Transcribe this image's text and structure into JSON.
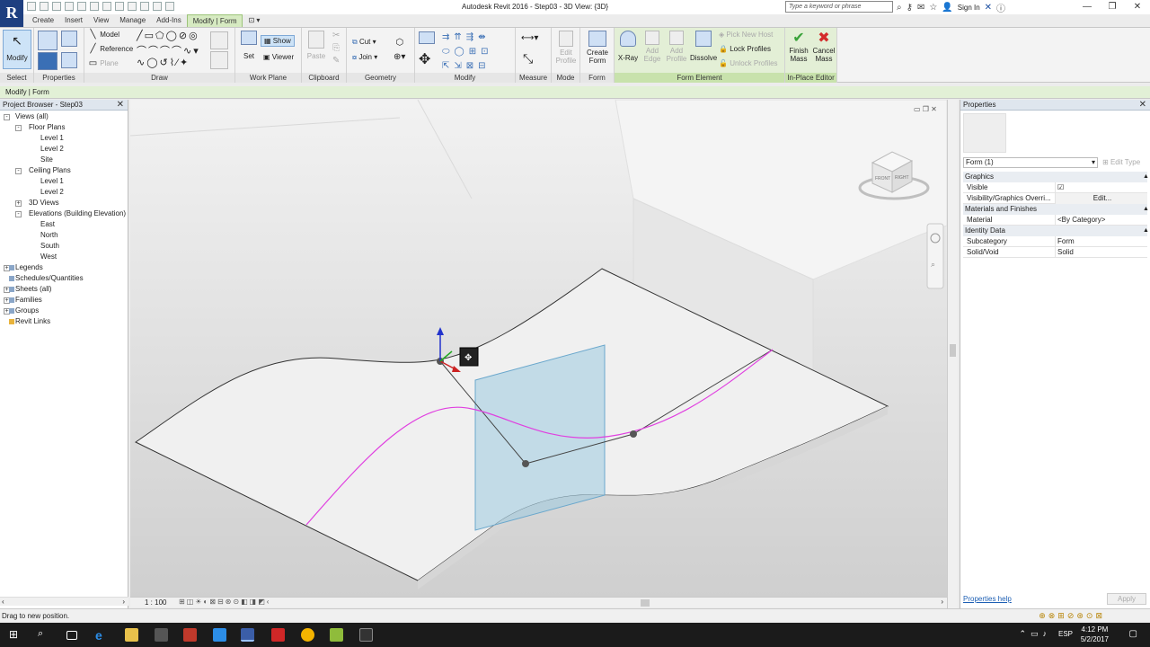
{
  "app": {
    "logo": "R",
    "title": "Autodesk Revit 2016 -    Step03 - 3D View: {3D}",
    "search_placeholder": "Type a keyword or phrase",
    "sign_in": "Sign In"
  },
  "tabs": [
    "Create",
    "Insert",
    "View",
    "Manage",
    "Add-Ins",
    "Modify | Form"
  ],
  "ribbon": {
    "select": {
      "modify": "Modify",
      "title": "Select"
    },
    "properties": {
      "title": "Properties"
    },
    "draw": {
      "model": "Model",
      "reference": "Reference",
      "plane": "Plane",
      "title": "Draw"
    },
    "work_plane": {
      "set": "Set",
      "show": "Show",
      "viewer": "Viewer",
      "title": "Work Plane"
    },
    "clipboard": {
      "paste": "Paste",
      "title": "Clipboard"
    },
    "geometry": {
      "cut": "Cut",
      "join": "Join",
      "title": "Geometry"
    },
    "modify": {
      "title": "Modify"
    },
    "measure": {
      "title": "Measure"
    },
    "mode": {
      "edit_profile": "Edit Profile",
      "title": "Mode"
    },
    "form": {
      "create_form": "Create Form",
      "title": "Form"
    },
    "form_element": {
      "xray": "X-Ray",
      "add_edge": "Add Edge",
      "add_profile": "Add Profile",
      "dissolve": "Dissolve",
      "pick_new_host": "Pick New Host",
      "lock_profiles": "Lock Profiles",
      "unlock_profiles": "Unlock Profiles",
      "title": "Form Element"
    },
    "inplace": {
      "finish": "Finish Mass",
      "cancel": "Cancel Mass",
      "title": "In-Place Editor"
    }
  },
  "option_bar": "Modify | Form",
  "project_browser": {
    "title": "Project Browser - Step03",
    "items": [
      {
        "label": "Views (all)",
        "level": 0
      },
      {
        "label": "Floor Plans",
        "level": 1
      },
      {
        "label": "Level 1",
        "level": 2
      },
      {
        "label": "Level 2",
        "level": 2
      },
      {
        "label": "Site",
        "level": 2
      },
      {
        "label": "Ceiling Plans",
        "level": 1
      },
      {
        "label": "Level 1",
        "level": 2
      },
      {
        "label": "Level 2",
        "level": 2
      },
      {
        "label": "3D Views",
        "level": 1
      },
      {
        "label": "Elevations (Building Elevation)",
        "level": 1
      },
      {
        "label": "East",
        "level": 2
      },
      {
        "label": "North",
        "level": 2
      },
      {
        "label": "South",
        "level": 2
      },
      {
        "label": "West",
        "level": 2
      },
      {
        "label": "Legends",
        "level": 0
      },
      {
        "label": "Schedules/Quantities",
        "level": 0
      },
      {
        "label": "Sheets (all)",
        "level": 0
      },
      {
        "label": "Families",
        "level": 0
      },
      {
        "label": "Groups",
        "level": 0
      },
      {
        "label": "Revit Links",
        "level": 0
      }
    ]
  },
  "view": {
    "scale": "1 : 100",
    "viewcube_front": "FRONT",
    "viewcube_right": "RIGHT"
  },
  "properties": {
    "title": "Properties",
    "type_selector": "Form (1)",
    "edit_type": "Edit Type",
    "groups": [
      {
        "name": "Graphics",
        "rows": [
          {
            "k": "Visible",
            "v": "☑"
          },
          {
            "k": "Visibility/Graphics Overri...",
            "v": "Edit..."
          }
        ]
      },
      {
        "name": "Materials and Finishes",
        "rows": [
          {
            "k": "Material",
            "v": "<By Category>"
          }
        ]
      },
      {
        "name": "Identity Data",
        "rows": [
          {
            "k": "Subcategory",
            "v": "Form"
          },
          {
            "k": "Solid/Void",
            "v": "Solid"
          }
        ]
      }
    ],
    "help_link": "Properties help",
    "apply": "Apply"
  },
  "status": {
    "message": "Drag to new position."
  },
  "taskbar": {
    "lang": "ESP",
    "time": "4:12 PM",
    "date": "5/2/2017"
  },
  "colors": {
    "accent": "#1e3f80",
    "context_green": "#d6eac1",
    "curve_magenta": "#e040e0",
    "plane_blue": "#9ccbe0"
  }
}
